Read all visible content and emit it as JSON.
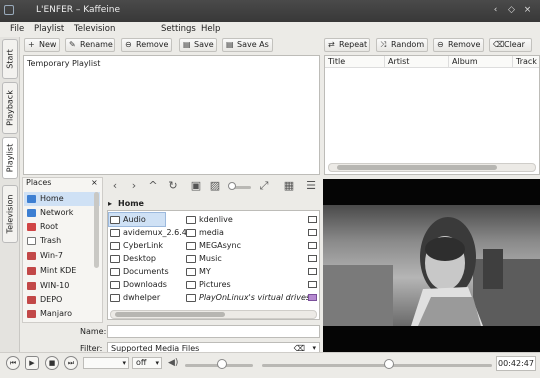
{
  "window": {
    "title": "L'ENFER – Kaffeine"
  },
  "menu": [
    "File",
    "Playlist",
    "Television",
    "Settings",
    "Help"
  ],
  "side_tabs": [
    "Start",
    "Playback",
    "Playlist",
    "Television"
  ],
  "toolbar_left": {
    "new": "New",
    "rename": "Rename",
    "remove": "Remove",
    "save": "Save",
    "save_as": "Save As"
  },
  "toolbar_right": {
    "repeat": "Repeat",
    "random": "Random",
    "remove": "Remove",
    "clear": "Clear"
  },
  "playlist_list": {
    "item": "Temporary Playlist"
  },
  "track_columns": [
    "Title",
    "Artist",
    "Album",
    "Track"
  ],
  "places": {
    "title": "Places",
    "items": [
      {
        "label": "Home",
        "color": "#3d7fd2"
      },
      {
        "label": "Network",
        "color": "#3d7fd2"
      },
      {
        "label": "Root",
        "color": "#d04545"
      },
      {
        "label": "Trash",
        "color": "#777777"
      },
      {
        "label": "Win-7",
        "color": "#c24848"
      },
      {
        "label": "Mint KDE",
        "color": "#c24848"
      },
      {
        "label": "WIN-10",
        "color": "#c24848"
      },
      {
        "label": "DEPO",
        "color": "#c24848"
      },
      {
        "label": "Manjaro",
        "color": "#c24848"
      }
    ]
  },
  "browser": {
    "breadcrumb": "Home",
    "files_col1": [
      "Audio",
      "avidemux_2.6.4",
      "CyberLink",
      "Desktop",
      "Documents",
      "Downloads",
      "dwhelper"
    ],
    "files_col2": [
      "kdenlive",
      "media",
      "MEGAsync",
      "Music",
      "MY",
      "Pictures",
      "PlayOnLinux's virtual drives"
    ]
  },
  "name_field": {
    "label": "Name:",
    "value": ""
  },
  "filter_field": {
    "label": "Filter:",
    "value": "Supported Media Files"
  },
  "player": {
    "subtitle_option": "off",
    "time": "00:42:47",
    "volume": 0.55,
    "position": 0.55
  }
}
